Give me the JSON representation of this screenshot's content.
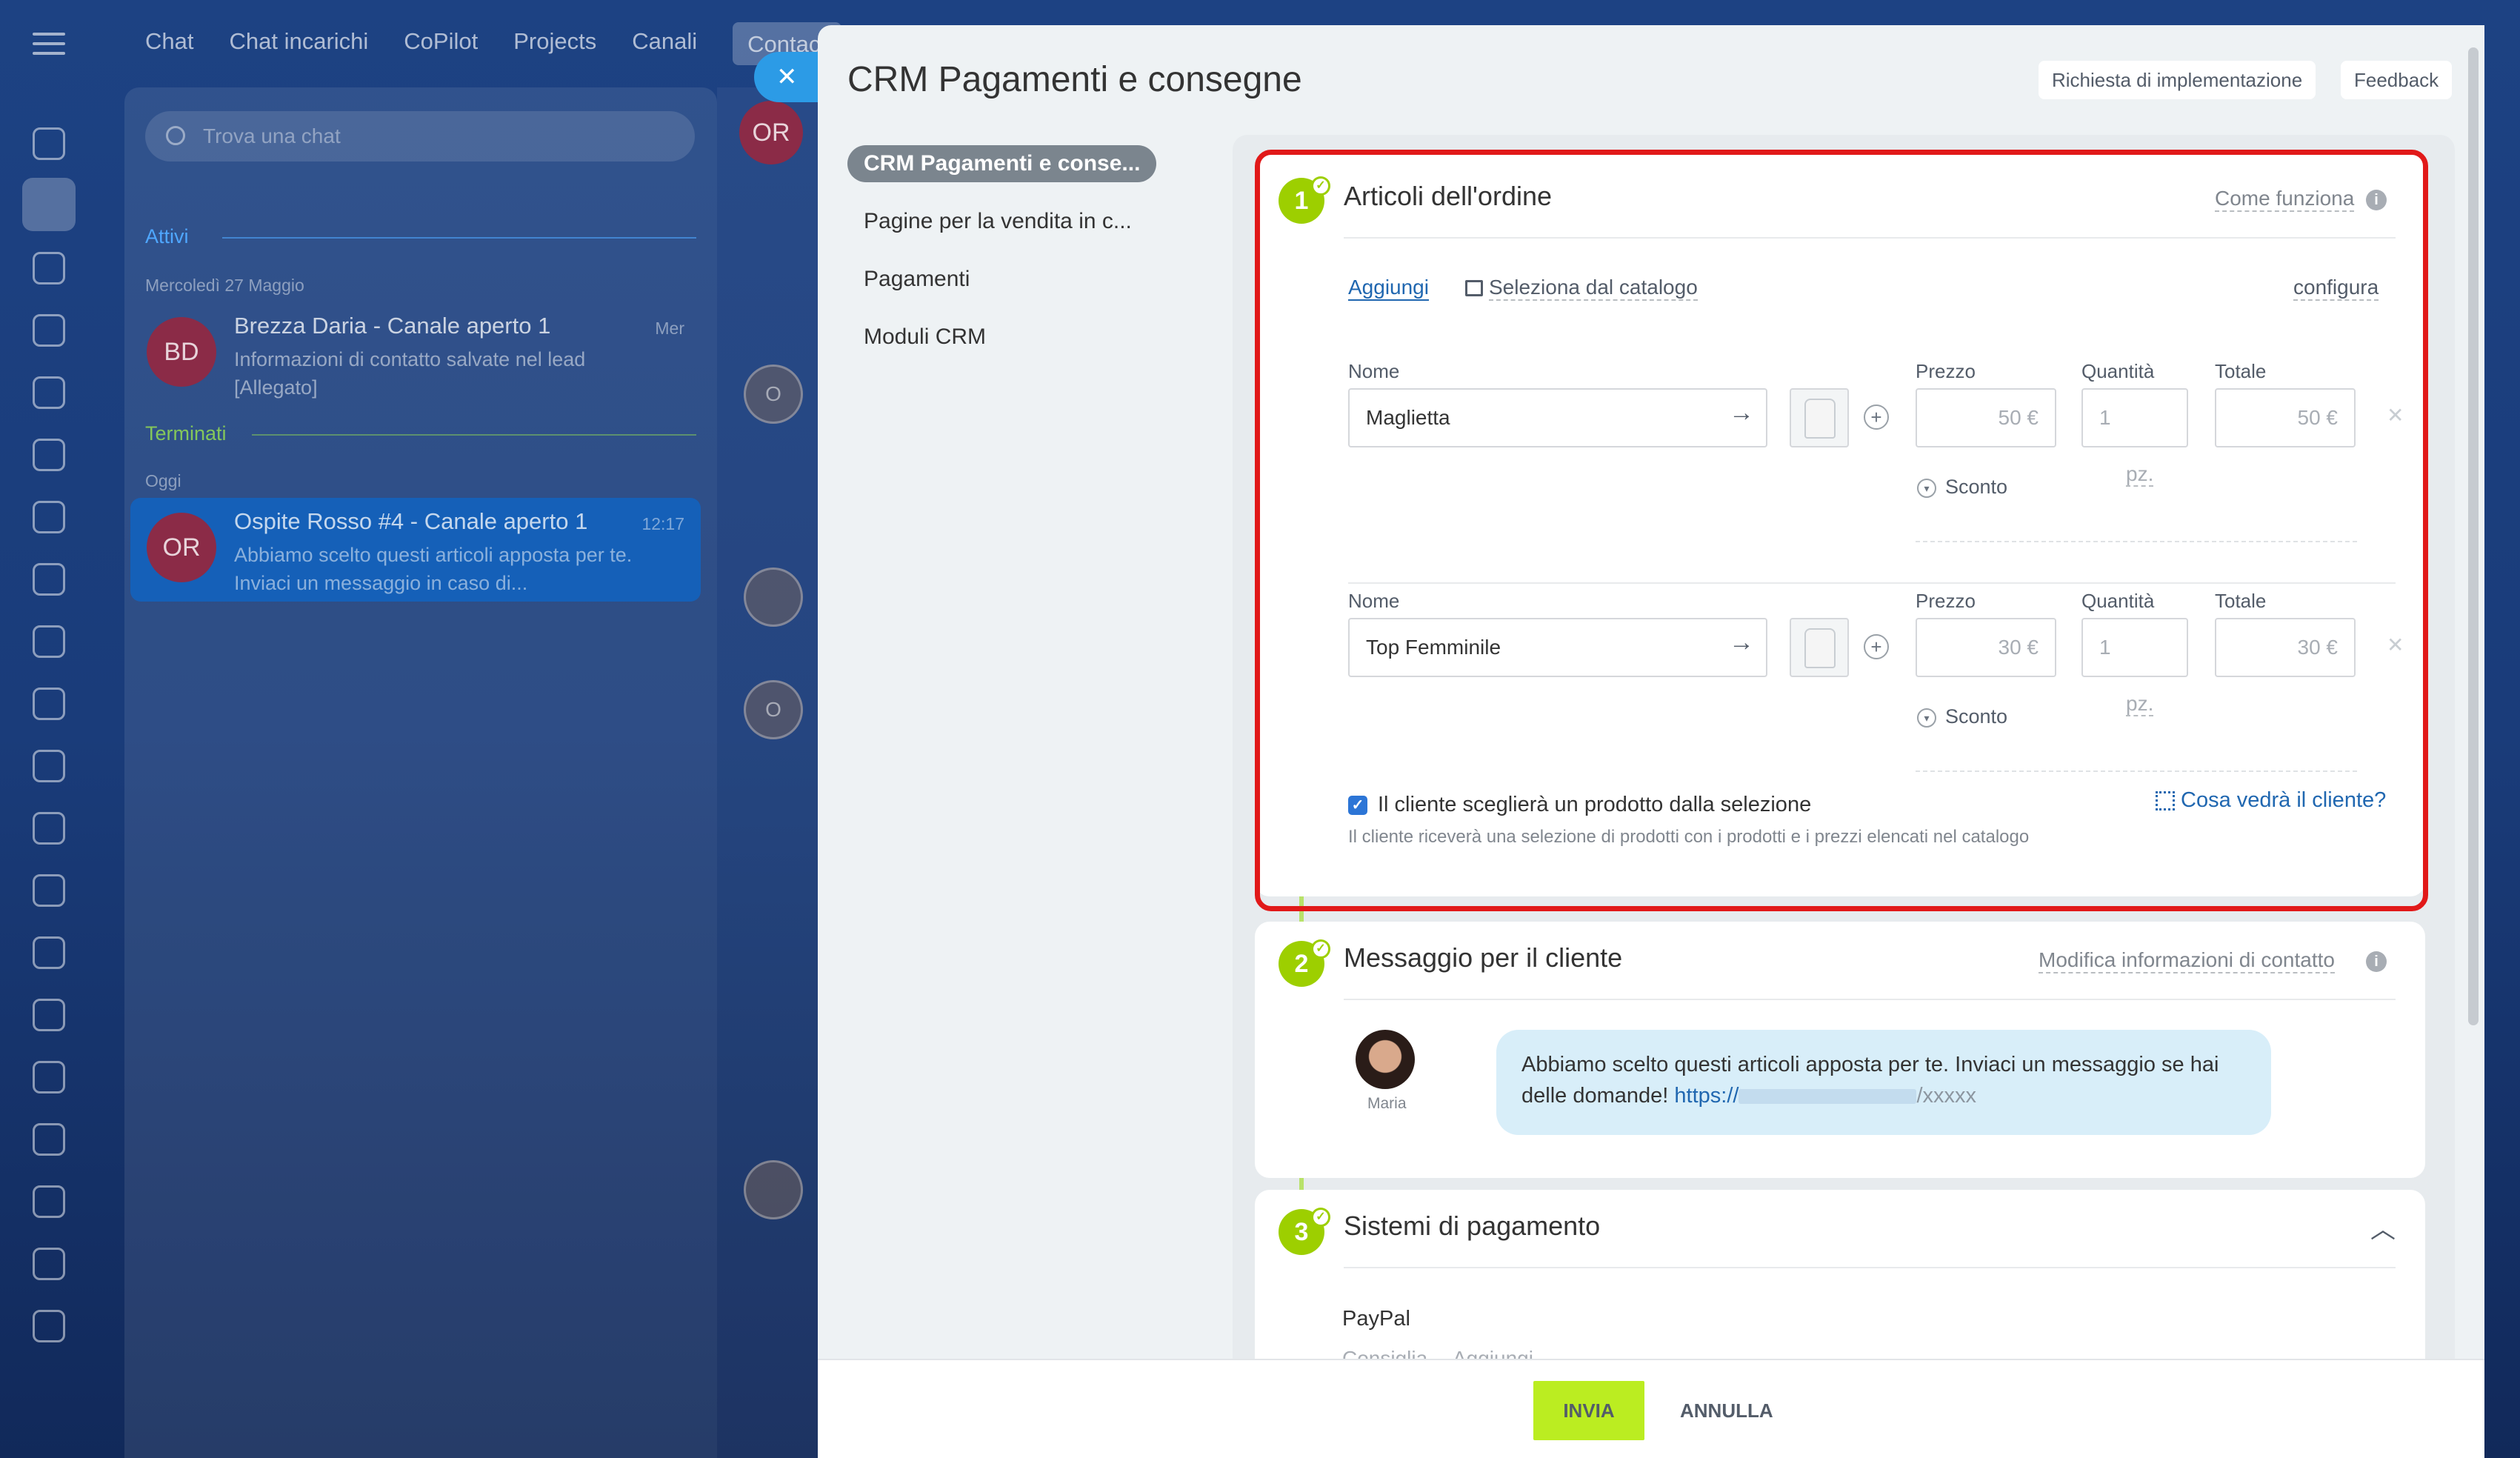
{
  "bg_app": {
    "nav_tabs": [
      "Chat",
      "Chat incarichi",
      "CoPilot",
      "Projects",
      "Canali",
      "Contact"
    ],
    "search_placeholder": "Trova una chat",
    "section_active": "Attivi",
    "section_done": "Terminati",
    "date_1": "Mercoledì 27 Maggio",
    "date_2": "Oggi",
    "chats": [
      {
        "initials": "BD",
        "title": "Brezza Daria - Canale aperto 1",
        "time": "Mer",
        "preview": "Informazioni di contatto salvate nel lead [Allegato]"
      },
      {
        "initials": "OR",
        "title": "Ospite Rosso #4 - Canale aperto 1",
        "time": "12:17",
        "preview": "Abbiamo scelto questi articoli apposta per te. Inviaci un messaggio in caso di..."
      }
    ],
    "header_avatar": "OR",
    "mid_avatar_letter": "O"
  },
  "panel": {
    "title": "CRM Pagamenti e consegne",
    "header_buttons": {
      "implement": "Richiesta di implementazione",
      "feedback": "Feedback"
    },
    "side_nav": [
      {
        "label": "CRM Pagamenti e conse...",
        "active": true
      },
      {
        "label": "Pagine per la vendita in c...",
        "active": false
      },
      {
        "label": "Pagamenti",
        "active": false
      },
      {
        "label": "Moduli CRM",
        "active": false
      }
    ]
  },
  "step1": {
    "number": "1",
    "title": "Articoli dell'ordine",
    "help_link": "Come funziona",
    "add_link": "Aggiungi",
    "catalog_link": "Seleziona dal catalogo",
    "configure_link": "configura",
    "labels": {
      "name": "Nome",
      "price": "Prezzo",
      "quantity": "Quantità",
      "total": "Totale",
      "discount": "Sconto"
    },
    "products": [
      {
        "name": "Maglietta",
        "price": "50 €",
        "qty": "1",
        "unit": "pz.",
        "total": "50 €"
      },
      {
        "name": "Top Femminile",
        "price": "30 €",
        "qty": "1",
        "unit": "pz.",
        "total": "30 €"
      }
    ],
    "checkbox_label": "Il cliente sceglierà un prodotto dalla selezione",
    "checkbox_checked": true,
    "checkbox_hint": "Il cliente riceverà una selezione di prodotti con i prodotti e i prezzi elencati nel catalogo",
    "preview_link": "Cosa vedrà il cliente?"
  },
  "step2": {
    "number": "2",
    "title": "Messaggio per il cliente",
    "edit_link": "Modifica informazioni di contatto",
    "avatar_name": "Maria",
    "message_text": "Abbiamo scelto questi articoli apposta per te. Inviaci un messaggio se hai delle domande!",
    "message_url_start": "https://",
    "message_url_end": "/xxxxx"
  },
  "step3": {
    "number": "3",
    "title": "Sistemi di pagamento",
    "system_name": "PayPal",
    "link_recommend": "Consiglia",
    "link_add": "Aggiungi"
  },
  "footer": {
    "send": "INVIA",
    "cancel": "ANNULLA"
  },
  "colors": {
    "accent_green": "#9dcf00",
    "send_button": "#bbed21",
    "highlight_red": "#e11919",
    "link_blue": "#2067b0"
  }
}
